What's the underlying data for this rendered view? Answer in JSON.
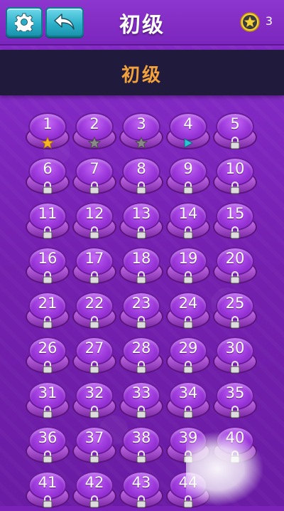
{
  "header": {
    "title": "初级",
    "star_count": "3",
    "settings_icon": "gear-icon",
    "back_icon": "back-arrow-icon"
  },
  "banner": {
    "title": "初级"
  },
  "colors": {
    "accent": "#f2a13b",
    "button": "#2aaec8",
    "bg": "#7a22b8"
  },
  "levels": [
    {
      "n": "1",
      "state": "star-gold"
    },
    {
      "n": "2",
      "state": "star-gray"
    },
    {
      "n": "3",
      "state": "star-gray"
    },
    {
      "n": "4",
      "state": "play"
    },
    {
      "n": "5",
      "state": "locked"
    },
    {
      "n": "6",
      "state": "locked"
    },
    {
      "n": "7",
      "state": "locked"
    },
    {
      "n": "8",
      "state": "locked"
    },
    {
      "n": "9",
      "state": "locked"
    },
    {
      "n": "10",
      "state": "locked"
    },
    {
      "n": "11",
      "state": "locked"
    },
    {
      "n": "12",
      "state": "locked"
    },
    {
      "n": "13",
      "state": "locked"
    },
    {
      "n": "14",
      "state": "locked"
    },
    {
      "n": "15",
      "state": "locked"
    },
    {
      "n": "16",
      "state": "locked"
    },
    {
      "n": "17",
      "state": "locked"
    },
    {
      "n": "18",
      "state": "locked"
    },
    {
      "n": "19",
      "state": "locked"
    },
    {
      "n": "20",
      "state": "locked"
    },
    {
      "n": "21",
      "state": "locked"
    },
    {
      "n": "22",
      "state": "locked"
    },
    {
      "n": "23",
      "state": "locked"
    },
    {
      "n": "24",
      "state": "locked"
    },
    {
      "n": "25",
      "state": "locked"
    },
    {
      "n": "26",
      "state": "locked"
    },
    {
      "n": "27",
      "state": "locked"
    },
    {
      "n": "28",
      "state": "locked"
    },
    {
      "n": "29",
      "state": "locked"
    },
    {
      "n": "30",
      "state": "locked"
    },
    {
      "n": "31",
      "state": "locked"
    },
    {
      "n": "32",
      "state": "locked"
    },
    {
      "n": "33",
      "state": "locked"
    },
    {
      "n": "34",
      "state": "locked"
    },
    {
      "n": "35",
      "state": "locked"
    },
    {
      "n": "36",
      "state": "locked"
    },
    {
      "n": "37",
      "state": "locked"
    },
    {
      "n": "38",
      "state": "locked"
    },
    {
      "n": "39",
      "state": "locked"
    },
    {
      "n": "40",
      "state": "locked"
    },
    {
      "n": "41",
      "state": "locked"
    },
    {
      "n": "42",
      "state": "locked"
    },
    {
      "n": "43",
      "state": "locked"
    },
    {
      "n": "44",
      "state": "locked"
    }
  ]
}
